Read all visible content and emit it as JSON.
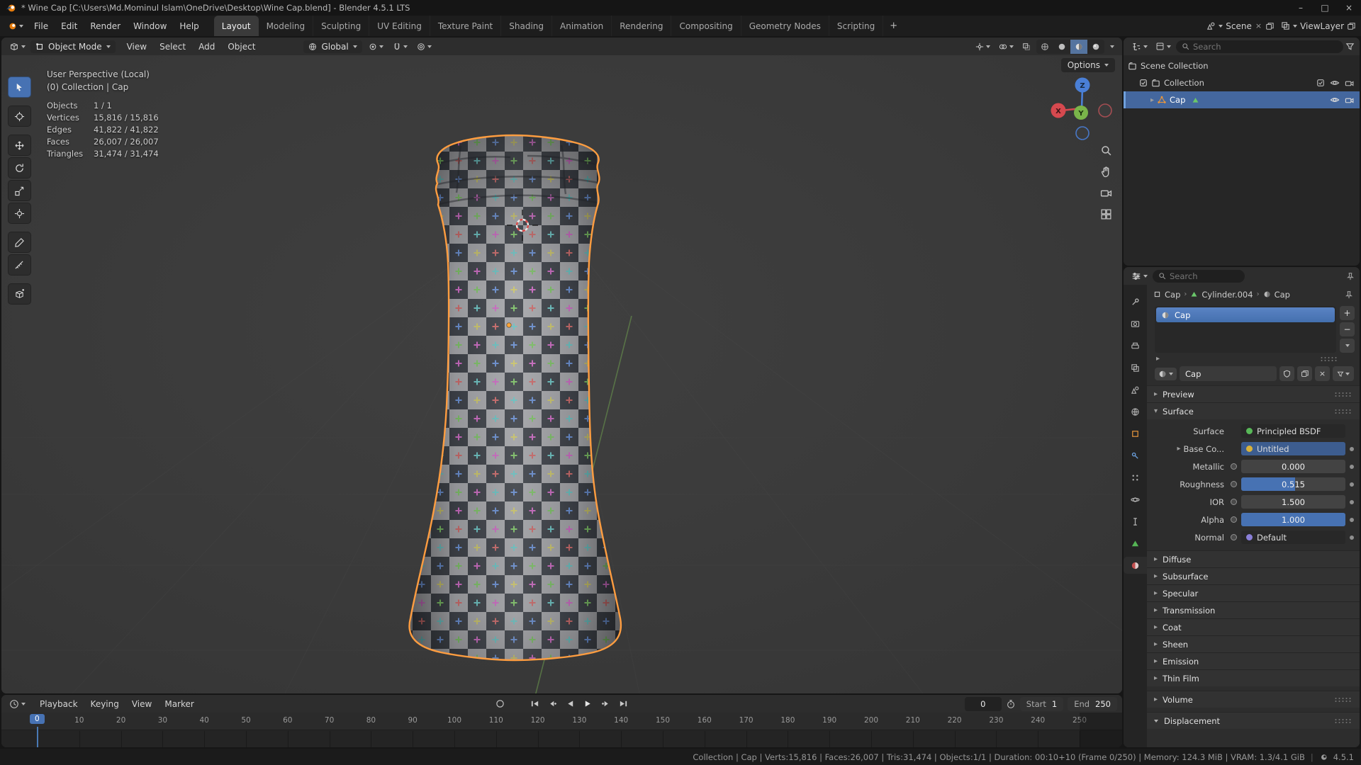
{
  "titlebar": {
    "title": "* Wine Cap [C:\\Users\\Md.Mominul Islam\\OneDrive\\Desktop\\Wine Cap.blend] - Blender 4.5.1 LTS",
    "minimize": "–",
    "maximize": "□",
    "close": "×"
  },
  "topbar": {
    "menus": [
      "File",
      "Edit",
      "Render",
      "Window",
      "Help"
    ],
    "workspaces": [
      {
        "label": "Layout",
        "active": true
      },
      {
        "label": "Modeling"
      },
      {
        "label": "Sculpting"
      },
      {
        "label": "UV Editing"
      },
      {
        "label": "Texture Paint"
      },
      {
        "label": "Shading"
      },
      {
        "label": "Animation"
      },
      {
        "label": "Rendering"
      },
      {
        "label": "Compositing"
      },
      {
        "label": "Geometry Nodes"
      },
      {
        "label": "Scripting"
      }
    ],
    "add_tab": "+",
    "scene": {
      "label": "Scene"
    },
    "viewlayer": {
      "label": "ViewLayer"
    }
  },
  "viewport": {
    "header": {
      "mode": "Object Mode",
      "menus": [
        "View",
        "Select",
        "Add",
        "Object"
      ],
      "orientation": "Global",
      "options_label": "Options"
    },
    "overlay": {
      "line1": "User Perspective (Local)",
      "line2": "(0) Collection | Cap"
    },
    "stats": [
      {
        "label": "Objects",
        "value": "1 / 1"
      },
      {
        "label": "Vertices",
        "value": "15,816 / 15,816"
      },
      {
        "label": "Edges",
        "value": "41,822 / 41,822"
      },
      {
        "label": "Faces",
        "value": "26,007 / 26,007"
      },
      {
        "label": "Triangles",
        "value": "31,474 / 31,474"
      }
    ],
    "gizmo": {
      "x": "X",
      "y": "Y",
      "z": "Z"
    }
  },
  "outliner": {
    "search_placeholder": "Search",
    "rows": [
      {
        "label": "Scene Collection"
      },
      {
        "label": "Collection"
      },
      {
        "label": "Cap"
      }
    ]
  },
  "properties": {
    "search_placeholder": "Search",
    "breadcrumb": [
      {
        "label": "Cap"
      },
      {
        "label": "Cylinder.004"
      },
      {
        "label": "Cap"
      }
    ],
    "slot": {
      "name": "Cap",
      "add": "+",
      "remove": "−"
    },
    "name_field": "Cap",
    "preview_label": "Preview",
    "surface_label": "Surface",
    "surface_rows": [
      {
        "label": "Surface",
        "type": "menu",
        "value": "Principled BSDF",
        "icon_color": "#58b858",
        "socket": false,
        "decorator": false
      },
      {
        "label": "Base Co...",
        "type": "menu",
        "value": "Untitled",
        "icon_color": "#d9b23a",
        "tint": "#3d5d8f",
        "chevron": true,
        "socket": false,
        "decorator": true
      },
      {
        "label": "Metallic",
        "type": "slider",
        "value": "0.000",
        "fill": 0,
        "socket": true,
        "decorator": true
      },
      {
        "label": "Roughness",
        "type": "slider",
        "value": "0.515",
        "fill": 0.515,
        "socket": true,
        "decorator": true
      },
      {
        "label": "IOR",
        "type": "field",
        "value": "1.500",
        "socket": true,
        "decorator": true
      },
      {
        "label": "Alpha",
        "type": "slider",
        "value": "1.000",
        "fill": 1,
        "socket": true,
        "decorator": true
      },
      {
        "label": "Normal",
        "type": "menu",
        "value": "Default",
        "icon_color": "#8a7fd8",
        "socket": true,
        "decorator": true
      }
    ],
    "sections": [
      {
        "label": "Diffuse"
      },
      {
        "label": "Subsurface"
      },
      {
        "label": "Specular"
      },
      {
        "label": "Transmission"
      },
      {
        "label": "Coat"
      },
      {
        "label": "Sheen"
      },
      {
        "label": "Emission"
      },
      {
        "label": "Thin Film"
      },
      {
        "label": "Volume",
        "group": true
      },
      {
        "label": "Displacement",
        "group": true,
        "expanded": true
      }
    ]
  },
  "timeline": {
    "menus": [
      "Playback",
      "Keying",
      "View",
      "Marker"
    ],
    "frame_field": "0",
    "playhead_frame": "0",
    "start_label": "Start",
    "start_value": "1",
    "end_label": "End",
    "end_value": "250",
    "ticks": [
      "0",
      "10",
      "20",
      "30",
      "40",
      "50",
      "60",
      "70",
      "80",
      "90",
      "100",
      "110",
      "120",
      "130",
      "140",
      "150",
      "160",
      "170",
      "180",
      "190",
      "200",
      "210",
      "220",
      "230",
      "240",
      "250"
    ]
  },
  "statusbar": {
    "text": "Collection | Cap | Verts:15,816 | Faces:26,007 | Tris:31,474 | Objects:1/1 | Duration: 00:10+10 (Frame 0/250) | Memory: 124.3 MiB | VRAM: 1.3/4.1 GiB",
    "version": "4.5.1"
  },
  "colors": {
    "accent": "#4772b3",
    "selection_outline": "#ff9d40"
  }
}
